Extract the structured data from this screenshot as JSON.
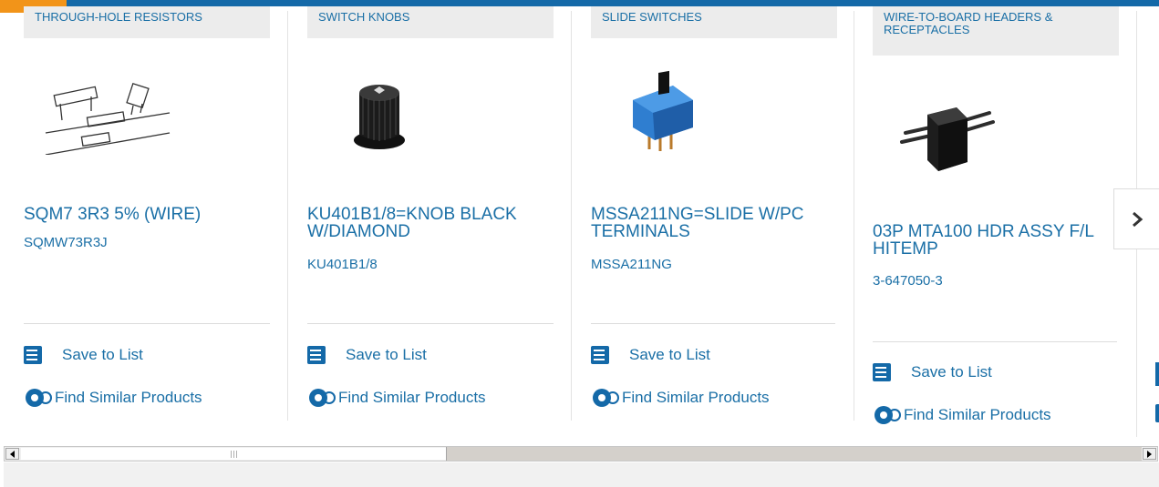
{
  "carousel": {
    "cards": [
      {
        "category": "THROUGH-HOLE RESISTORS",
        "title": "SQM7 3R3 5% (WIRE)",
        "part_number": "SQMW73R3J",
        "save_label": "Save to List",
        "find_label": "Find Similar Products"
      },
      {
        "category": "SWITCH KNOBS",
        "title": "KU401B1/8=KNOB BLACK W/DIAMOND",
        "part_number": "KU401B1/8",
        "save_label": "Save to List",
        "find_label": "Find Similar Products"
      },
      {
        "category": "SLIDE SWITCHES",
        "title": "MSSA211NG=SLIDE W/PC TERMINALS",
        "part_number": "MSSA211NG",
        "save_label": "Save to List",
        "find_label": "Find Similar Products"
      },
      {
        "category": "WIRE-TO-BOARD HEADERS & RECEPTACLES",
        "title": "03P MTA100 HDR ASSY F/L HITEMP",
        "part_number": "3-647050-3",
        "save_label": "Save to List",
        "find_label": "Find Similar Products"
      }
    ],
    "next_icon": "chevron-right-icon"
  },
  "colors": {
    "brand_blue": "#1469a8",
    "link_blue": "#1a6fa6",
    "accent_orange": "#f29419"
  }
}
